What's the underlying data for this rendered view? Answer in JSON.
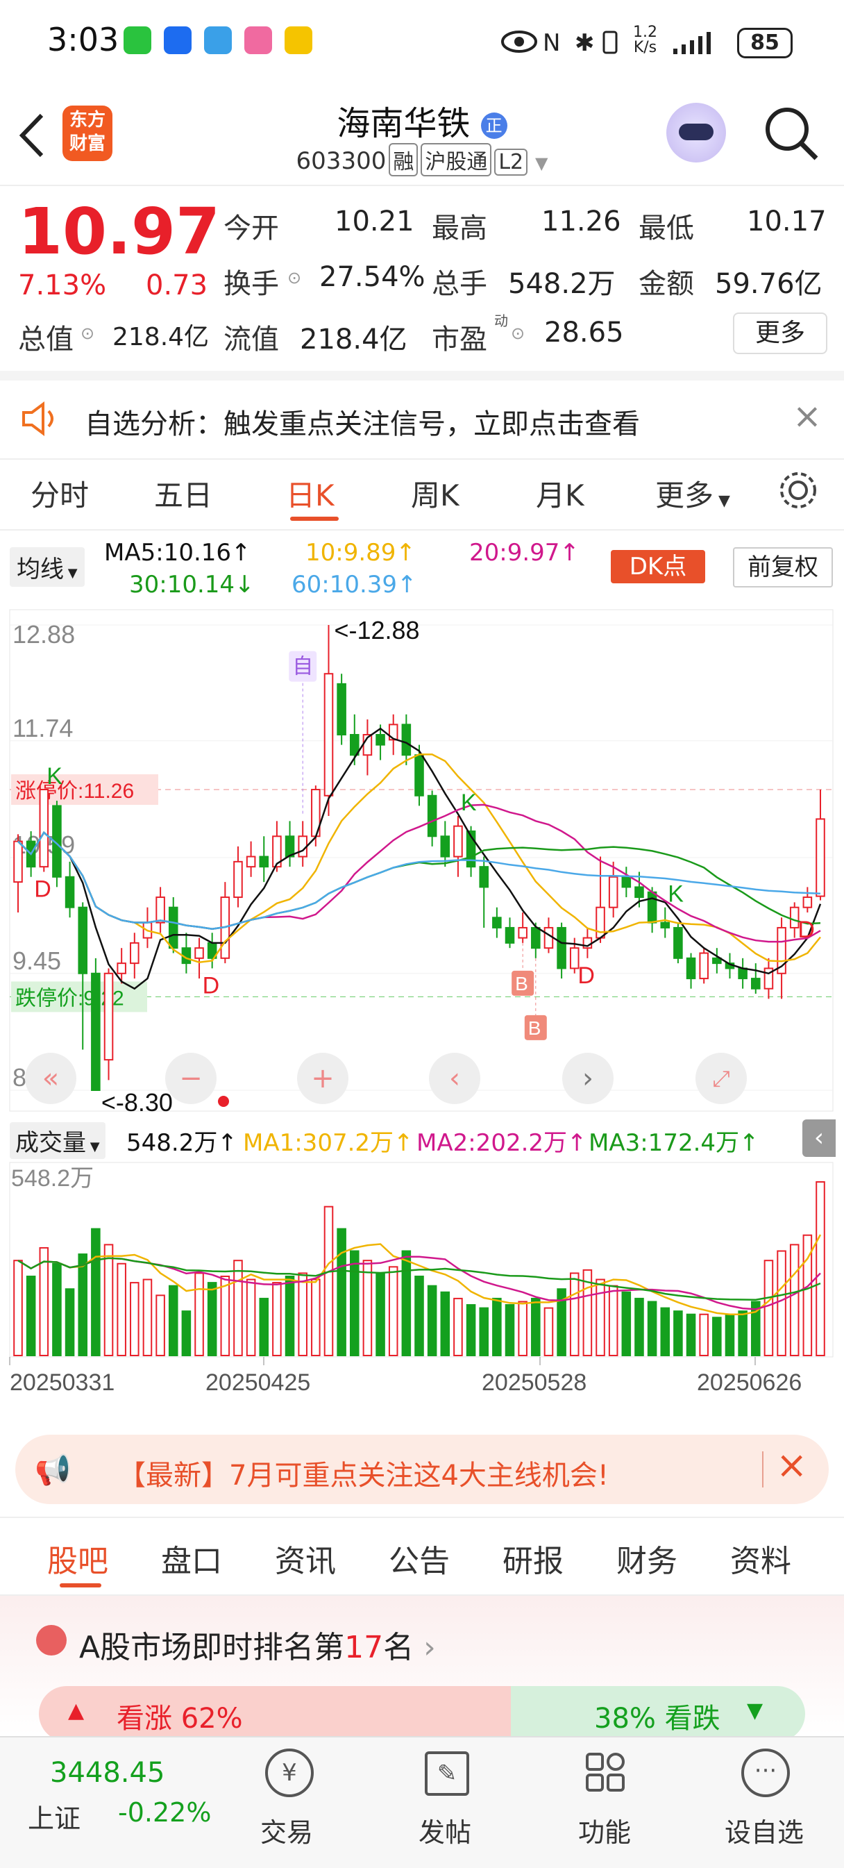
{
  "status": {
    "time": "3:03",
    "speed_top": "1.2",
    "speed_unit": "K/s",
    "battery": "85"
  },
  "header": {
    "title": "海南华铁",
    "badge": "正",
    "code": "603300",
    "tag_rong": "融",
    "tag_hgt": "沪股通",
    "tag_l2": "L2",
    "logo_line1": "东方",
    "logo_line2": "财富"
  },
  "quote": {
    "price": "10.97",
    "pct": "7.13%",
    "chg": "0.73",
    "open_label": "今开",
    "open": "10.21",
    "high_label": "最高",
    "high": "11.26",
    "low_label": "最低",
    "low": "10.17",
    "turnover_label": "换手",
    "turnover": "27.54%",
    "volume_label": "总手",
    "volume": "548.2万",
    "amount_label": "金额",
    "amount": "59.76亿",
    "mktcap_label": "总值",
    "mktcap": "218.4亿",
    "float_label": "流值",
    "float_cap": "218.4亿",
    "pe_label": "市盈",
    "pe_sup": "动",
    "pe": "28.65",
    "more_label": "更多"
  },
  "notice": {
    "text": "自选分析：触发重点关注信号，立即点击查看"
  },
  "ktabs": [
    {
      "label": "分时"
    },
    {
      "label": "五日"
    },
    {
      "label": "日K"
    },
    {
      "label": "周K"
    },
    {
      "label": "月K"
    },
    {
      "label": "更多"
    }
  ],
  "ma": {
    "selector": "均线",
    "ma5": "MA5:10.16",
    "ma10": "10:9.89",
    "ma20": "20:9.97",
    "ma30": "30:10.14",
    "ma60": "60:10.39",
    "dk": "DK点",
    "fq": "前复权",
    "colors": {
      "ma5": "#111111",
      "ma10": "#f0b400",
      "ma20": "#d0188c",
      "ma30": "#1a9a1a",
      "ma60": "#4aa8e8"
    }
  },
  "chart_data": {
    "type": "candlestick",
    "y_ticks": [
      "12.88",
      "11.74",
      "10.59",
      "9.45",
      "8.30"
    ],
    "ylim": [
      8.3,
      12.88
    ],
    "x_ticks": [
      "20250331",
      "20250425",
      "20250528",
      "20250626"
    ],
    "limit_up_label": "涨停价:11.26",
    "limit_up": 11.26,
    "limit_down_label": "跌停价:9.22",
    "limit_down": 9.22,
    "high_marker": "<-12.88",
    "low_marker": "<-8.30",
    "self_marker": "自",
    "candles": [
      [
        10.35,
        10.75,
        10.05,
        10.82
      ],
      [
        10.75,
        10.5,
        10.4,
        10.85
      ],
      [
        10.5,
        11.26,
        10.45,
        11.26
      ],
      [
        11.1,
        10.4,
        10.3,
        11.15
      ],
      [
        10.4,
        10.1,
        10.0,
        10.55
      ],
      [
        10.1,
        9.45,
        8.7,
        10.15
      ],
      [
        9.45,
        8.3,
        8.3,
        9.6
      ],
      [
        8.6,
        9.45,
        8.4,
        9.5
      ],
      [
        9.45,
        9.55,
        9.35,
        9.7
      ],
      [
        9.55,
        9.75,
        9.4,
        9.85
      ],
      [
        9.8,
        9.95,
        9.7,
        10.1
      ],
      [
        9.95,
        10.2,
        9.85,
        10.3
      ],
      [
        10.1,
        9.7,
        9.65,
        10.2
      ],
      [
        9.7,
        9.55,
        9.45,
        9.85
      ],
      [
        9.6,
        9.7,
        9.4,
        9.8
      ],
      [
        9.75,
        9.6,
        9.5,
        9.85
      ],
      [
        9.6,
        10.2,
        9.55,
        10.35
      ],
      [
        10.2,
        10.55,
        10.1,
        10.7
      ],
      [
        10.5,
        10.6,
        10.4,
        10.75
      ],
      [
        10.6,
        10.5,
        10.35,
        10.8
      ],
      [
        10.5,
        10.8,
        10.45,
        10.95
      ],
      [
        10.8,
        10.6,
        10.5,
        10.95
      ],
      [
        10.6,
        10.8,
        10.5,
        10.95
      ],
      [
        10.8,
        11.26,
        10.7,
        11.3
      ],
      [
        11.2,
        12.4,
        11.0,
        12.88
      ],
      [
        12.3,
        11.8,
        11.7,
        12.4
      ],
      [
        11.8,
        11.6,
        11.5,
        12.0
      ],
      [
        11.6,
        11.8,
        11.4,
        11.95
      ],
      [
        11.8,
        11.7,
        11.55,
        11.9
      ],
      [
        11.75,
        11.9,
        11.6,
        12.0
      ],
      [
        11.9,
        11.6,
        11.5,
        12.0
      ],
      [
        11.6,
        11.2,
        11.1,
        11.7
      ],
      [
        11.2,
        10.8,
        10.7,
        11.25
      ],
      [
        10.8,
        10.6,
        10.5,
        10.95
      ],
      [
        10.6,
        10.9,
        10.4,
        11.0
      ],
      [
        10.85,
        10.5,
        10.4,
        10.9
      ],
      [
        10.5,
        10.3,
        9.9,
        10.6
      ],
      [
        10.0,
        9.9,
        9.8,
        10.1
      ],
      [
        9.9,
        9.75,
        9.7,
        10.0
      ],
      [
        9.8,
        9.9,
        9.75,
        10.05
      ],
      [
        9.9,
        9.7,
        9.6,
        9.95
      ],
      [
        9.7,
        9.9,
        9.65,
        10.0
      ],
      [
        9.9,
        9.5,
        9.4,
        9.95
      ],
      [
        9.5,
        9.7,
        9.45,
        9.8
      ],
      [
        9.7,
        9.8,
        9.6,
        9.9
      ],
      [
        9.8,
        10.1,
        9.75,
        10.6
      ],
      [
        10.1,
        10.4,
        10.0,
        10.55
      ],
      [
        10.4,
        10.3,
        10.2,
        10.5
      ],
      [
        10.3,
        10.2,
        10.1,
        10.45
      ],
      [
        10.25,
        9.95,
        9.85,
        10.3
      ],
      [
        9.95,
        9.9,
        9.8,
        10.1
      ],
      [
        9.9,
        9.6,
        9.55,
        9.95
      ],
      [
        9.6,
        9.4,
        9.3,
        9.65
      ],
      [
        9.4,
        9.65,
        9.35,
        9.7
      ],
      [
        9.6,
        9.55,
        9.45,
        9.7
      ],
      [
        9.55,
        9.5,
        9.4,
        9.65
      ],
      [
        9.5,
        9.4,
        9.3,
        9.6
      ],
      [
        9.4,
        9.3,
        9.25,
        9.55
      ],
      [
        9.3,
        9.5,
        9.2,
        9.6
      ],
      [
        9.45,
        9.9,
        9.2,
        10.0
      ],
      [
        9.9,
        10.1,
        9.8,
        10.15
      ],
      [
        10.1,
        10.2,
        10.05,
        10.3
      ],
      [
        10.21,
        10.97,
        10.17,
        11.26
      ]
    ],
    "signal_labels": [
      {
        "text": "K",
        "i": 2
      },
      {
        "text": "D",
        "i": 2
      },
      {
        "text": "D",
        "i": 15
      },
      {
        "text": "K",
        "i": 34
      },
      {
        "text": "D",
        "i": 44
      },
      {
        "text": "K",
        "i": 50
      },
      {
        "text": "D",
        "i": 61
      }
    ],
    "buy_markers": [
      {
        "text": "B",
        "i": 39
      },
      {
        "text": "B",
        "i": 40
      }
    ]
  },
  "volume": {
    "selector": "成交量",
    "value": "548.2万",
    "ma1": "MA1:307.2万",
    "ma2": "MA2:202.2万",
    "ma3": "MA3:172.4万",
    "axis_max": "548.2万",
    "max": 548.2,
    "bars": [
      300,
      250,
      340,
      290,
      210,
      320,
      400,
      350,
      290,
      230,
      240,
      190,
      220,
      140,
      260,
      230,
      250,
      300,
      240,
      180,
      230,
      250,
      260,
      240,
      470,
      400,
      330,
      300,
      260,
      280,
      330,
      250,
      220,
      200,
      180,
      160,
      150,
      180,
      160,
      170,
      180,
      150,
      210,
      260,
      270,
      240,
      220,
      200,
      180,
      170,
      150,
      140,
      130,
      130,
      120,
      130,
      140,
      170,
      300,
      330,
      350,
      380,
      548.2
    ]
  },
  "banner": {
    "text": "【最新】7月可重点关注这4大主线机会!"
  },
  "bottom_tabs": [
    {
      "label": "股吧"
    },
    {
      "label": "盘口"
    },
    {
      "label": "资讯"
    },
    {
      "label": "公告"
    },
    {
      "label": "研报"
    },
    {
      "label": "财务"
    },
    {
      "label": "资料"
    }
  ],
  "ranking": {
    "prefix": "A股市场即时排名第",
    "rank": "17",
    "suffix": "名",
    "bull": "看涨 62%",
    "bear": "38% 看跌"
  },
  "nav": {
    "index_value": "3448.45",
    "index_name": "上证",
    "index_change": "-0.22%",
    "trade": "交易",
    "post": "发帖",
    "func": "功能",
    "watch": "设自选"
  }
}
